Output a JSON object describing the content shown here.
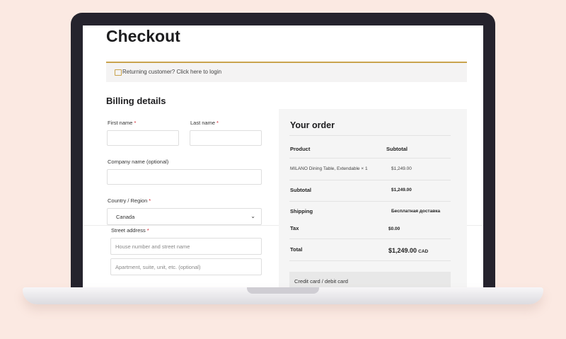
{
  "page": {
    "title": "Checkout"
  },
  "notice": {
    "text": "Returning customer? Click here to login"
  },
  "billing": {
    "title": "Billing details",
    "required_mark": "*",
    "first_name_label": "First name",
    "last_name_label": "Last name",
    "company_label": "Company name (optional)",
    "country_label": "Country / Region",
    "country_value": "Canada",
    "street_label": "Street address",
    "street_placeholder": "House number and street name",
    "apartment_placeholder": "Apartment, suite, unit, etc. (optional)"
  },
  "order": {
    "title": "Your order",
    "header_product": "Product",
    "header_subtotal": "Subtotal",
    "item_name": "MILANO Dining Table, Extendable",
    "item_qty": "× 1",
    "item_price": "$1,249.00",
    "subtotal_label": "Subtotal",
    "subtotal_value": "$1,249.00",
    "shipping_label": "Shipping",
    "shipping_value": "Бесплатная доставка",
    "tax_label": "Tax",
    "tax_value": "$0.00",
    "total_label": "Total",
    "total_value": "$1,249.00",
    "total_currency": "CAD",
    "payment_method": "Credit card / debit card"
  },
  "colors": {
    "background": "#fbe9e2",
    "laptop_frame": "#25232d",
    "accent": "#c9a34d",
    "required": "#d2222d"
  }
}
